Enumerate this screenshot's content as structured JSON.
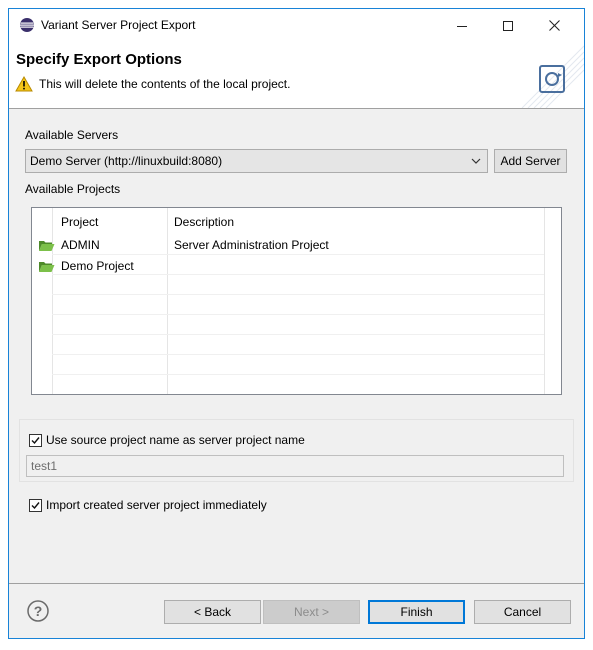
{
  "window": {
    "title": "Variant Server Project Export",
    "accent": "#1883d7"
  },
  "header": {
    "title": "Specify Export Options",
    "warning": "This will delete the contents of the local project."
  },
  "servers": {
    "label": "Available Servers",
    "selected": "Demo Server (http://linuxbuild:8080)",
    "add_button": "Add Server"
  },
  "projects": {
    "label": "Available Projects",
    "columns": [
      "Project",
      "Description"
    ],
    "rows": [
      {
        "project": "ADMIN",
        "description": "Server Administration Project",
        "icon": "folder-open-icon"
      },
      {
        "project": "Demo Project",
        "description": "",
        "icon": "folder-open-icon"
      }
    ]
  },
  "options": {
    "use_source_name_label": "Use source project name as server project name",
    "use_source_name_checked": true,
    "project_name_value": "test1",
    "import_label": "Import created server project immediately",
    "import_checked": true
  },
  "footer": {
    "back": "< Back",
    "next": "Next >",
    "finish": "Finish",
    "cancel": "Cancel"
  }
}
